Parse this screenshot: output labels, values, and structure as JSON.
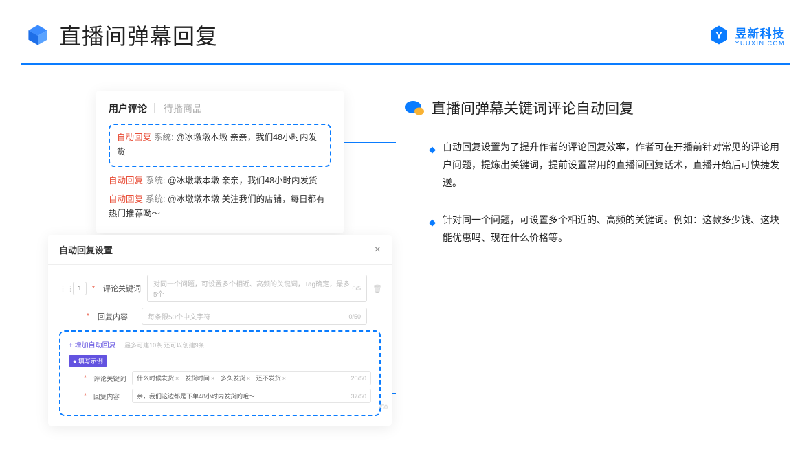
{
  "header": {
    "title": "直播间弹幕回复",
    "brand_name": "昱新科技",
    "brand_sub": "YUUXIN.COM"
  },
  "comments_card": {
    "tab_active": "用户评论",
    "tab_inactive": "待播商品",
    "highlighted": {
      "tag": "自动回复",
      "sys": "系统:",
      "text": "@冰墩墩本墩 亲亲，我们48小时内发货"
    },
    "lines": [
      {
        "tag": "自动回复",
        "sys": "系统:",
        "text": "@冰墩墩本墩 亲亲，我们48小时内发货"
      },
      {
        "tag": "自动回复",
        "sys": "系统:",
        "text": "@冰墩墩本墩 关注我们的店铺，每日都有热门推荐呦～"
      }
    ]
  },
  "settings": {
    "title": "自动回复设置",
    "order": "1",
    "kw_label": "评论关键词",
    "kw_placeholder": "对同一个问题，可设置多个相近、高频的关键词，Tag确定，最多5个",
    "kw_counter": "0/5",
    "content_label": "回复内容",
    "content_placeholder": "每条限50个中文字符",
    "content_counter": "0/50",
    "add_link": "+ 增加自动回复",
    "add_hint": "最多可建10条 还可以创建9条",
    "example_tag": "● 填写示例",
    "ex_kw_label": "评论关键词",
    "ex_tags": [
      "什么时候发货",
      "发货时间",
      "多久发货",
      "还不发货"
    ],
    "ex_kw_counter": "20/50",
    "ex_content_label": "回复内容",
    "ex_content_val": "亲，我们这边都是下单48小时内发货的哦～",
    "ex_content_counter": "37/50",
    "ext_counter": "/50"
  },
  "right": {
    "section_title": "直播间弹幕关键词评论自动回复",
    "bullets": [
      "自动回复设置为了提升作者的评论回复效率，作者可在开播前针对常见的评论用户问题，提炼出关键词，提前设置常用的直播间回复话术，直播开始后可快捷发送。",
      "针对同一个问题，可设置多个相近的、高频的关键词。例如：这款多少钱、这块能优惠吗、现在什么价格等。"
    ]
  }
}
